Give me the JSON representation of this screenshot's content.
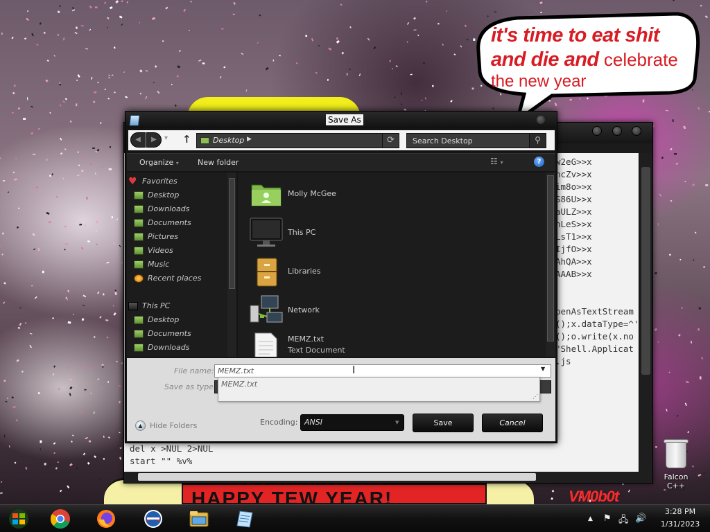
{
  "wallpaper": {
    "speech_line1": "it's time to eat shit",
    "speech_line2a": "and die and",
    "speech_line2b": " celebrate",
    "speech_line3": "the new year",
    "banner_text": "HAPPY TEW YEAR!",
    "sign_text": "VM0b0t"
  },
  "notepad": {
    "lines": [
      "w2eG>>x",
      "ncZv>>x",
      "im8o>>x",
      "S86U>>x",
      "aULZ>>x",
      "nLeS>>x",
      "LsT1>>x",
      "IjfO>>x",
      "AhQA>>x",
      "AAAB>>x",
      "",
      "",
      "penAsTextStream",
      "();x.dataType=^'",
      "();o.write(x.no",
      "\"Shell.Applicat",
      ".js"
    ],
    "bottom_lines": [
      "del x >NUL 2>NUL",
      "start \"\" %v%"
    ]
  },
  "dialog": {
    "title": "Save As",
    "address": "Desktop",
    "search_placeholder": "Search Desktop",
    "toolbar": {
      "organize": "Organize",
      "new_folder": "New folder",
      "organize_arrow": "▾",
      "view_arrow": "▾"
    },
    "nav_items": [
      {
        "label": "Favorites",
        "icon": "heart-icon"
      },
      {
        "label": "Desktop",
        "icon": "folder-icon"
      },
      {
        "label": "Downloads",
        "icon": "folder-icon"
      },
      {
        "label": "Documents",
        "icon": "folder-icon"
      },
      {
        "label": "Pictures",
        "icon": "folder-icon"
      },
      {
        "label": "Videos",
        "icon": "folder-icon"
      },
      {
        "label": "Music",
        "icon": "folder-icon"
      },
      {
        "label": "Recent places",
        "icon": "recent-places-icon"
      },
      {
        "label": "This PC",
        "icon": "computer-icon"
      },
      {
        "label": "Desktop",
        "icon": "folder-icon"
      },
      {
        "label": "Documents",
        "icon": "folder-icon"
      },
      {
        "label": "Downloads",
        "icon": "folder-icon"
      }
    ],
    "files": [
      {
        "name": "Molly McGee",
        "sub": "",
        "icon": "user-folder-icon"
      },
      {
        "name": "This PC",
        "sub": "",
        "icon": "computer-icon"
      },
      {
        "name": "Libraries",
        "sub": "",
        "icon": "libraries-icon"
      },
      {
        "name": "Network",
        "sub": "",
        "icon": "network-icon"
      },
      {
        "name": "MEMZ.txt",
        "sub": "Text Document",
        "icon": "text-document-icon"
      }
    ],
    "filename_label": "File name:",
    "filename_value": "MEMZ.txt",
    "savetype_label": "Save as type:",
    "autocomplete_item": "MEMZ.txt",
    "hide_folders": "Hide Folders",
    "encoding_label": "Encoding:",
    "encoding_value": "ANSI",
    "save_label": "Save",
    "cancel_label": "Cancel"
  },
  "desktop": {
    "recycle_bin_label": "Falcon C++"
  },
  "taskbar": {
    "apps": [
      "windows-start-icon",
      "chrome-icon",
      "firefox-icon",
      "internet-explorer-icon",
      "file-explorer-icon",
      "notepad-icon"
    ],
    "time": "3:28 PM",
    "date": "1/31/2023"
  }
}
